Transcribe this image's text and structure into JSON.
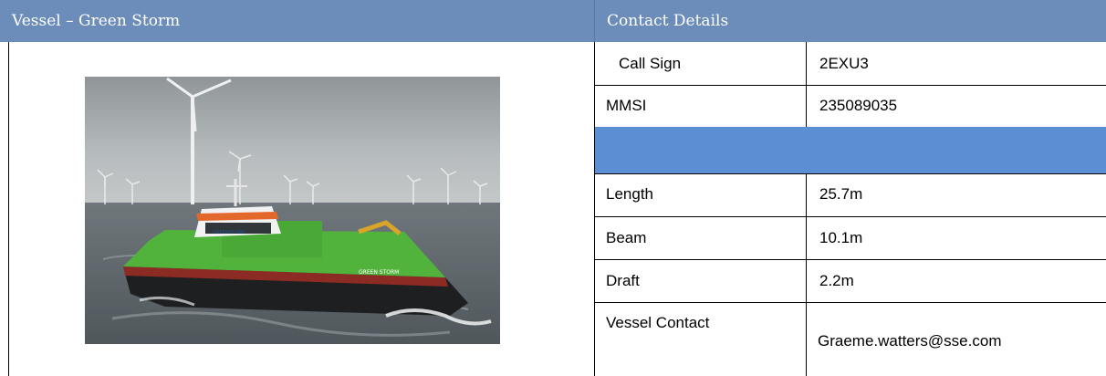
{
  "vessel_panel": {
    "title": "Vessel – Green Storm",
    "photo_hull_name": "GREEN STORM",
    "photo_hull_brand": "GREENSTORM"
  },
  "contact_panel": {
    "title": "Contact Details",
    "rows": [
      {
        "label": "Call Sign",
        "value": "2EXU3"
      },
      {
        "label": "MMSI",
        "value": "235089035"
      },
      {
        "label": "Length",
        "value": "25.7m"
      },
      {
        "label": "Beam",
        "value": "10.1m"
      },
      {
        "label": "Draft",
        "value": "2.2m"
      },
      {
        "label": "Vessel Contact",
        "value": "Graeme.watters@sse.com"
      }
    ]
  },
  "colors": {
    "header_bg": "#6c8db9",
    "band_bg": "#5b8fd4",
    "hull_green": "#52b33c"
  }
}
